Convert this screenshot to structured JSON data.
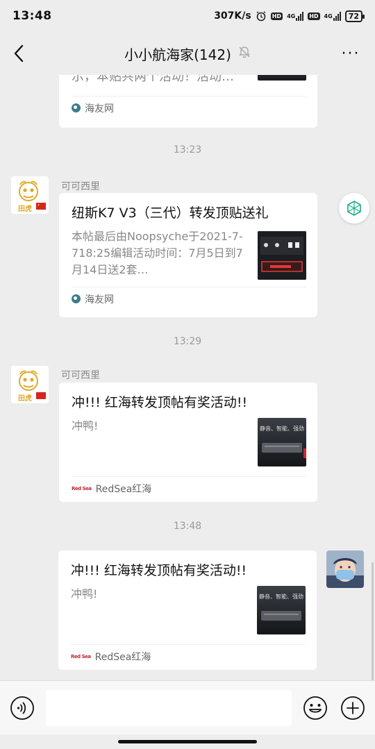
{
  "status": {
    "time": "13:48",
    "speed": "307K/s",
    "battery": "72",
    "hd": "HD",
    "net": "4G"
  },
  "header": {
    "title": "小小航海家(142)",
    "more": "···"
  },
  "messages": [
    {
      "id": "m0",
      "title_partial": "示，本贴共两个活动！活动…",
      "source": "海友网"
    },
    {
      "id": "m1",
      "timestamp": "13:23",
      "sender": "可可西里",
      "title": "纽斯K7 V3（三代）转发顶贴送礼",
      "desc": "本帖最后由Noopsyche于2021-7-718:25编辑活动时间：7月5日到7月14日送2套…",
      "source": "海友网"
    },
    {
      "id": "m2",
      "timestamp": "13:29",
      "sender": "可可西里",
      "title": "冲!!! 红海转发顶帖有奖活动!!",
      "desc": "冲鸭!",
      "source": "RedSea红海"
    },
    {
      "id": "m3",
      "timestamp": "13:48",
      "title": "冲!!! 红海转发顶帖有奖活动!!",
      "desc": "冲鸭!",
      "source": "RedSea红海"
    }
  ],
  "thumb_text": {
    "redsea_caption": "静音、智能、强劲"
  },
  "avatar": {
    "cc_badge": "田虎"
  },
  "input": {
    "placeholder": ""
  },
  "colors": {
    "background": "#ededed",
    "card": "#ffffff",
    "meta_text": "#999999",
    "source_icon": "#3b7d89",
    "redsea_brand": "#c0262d"
  }
}
